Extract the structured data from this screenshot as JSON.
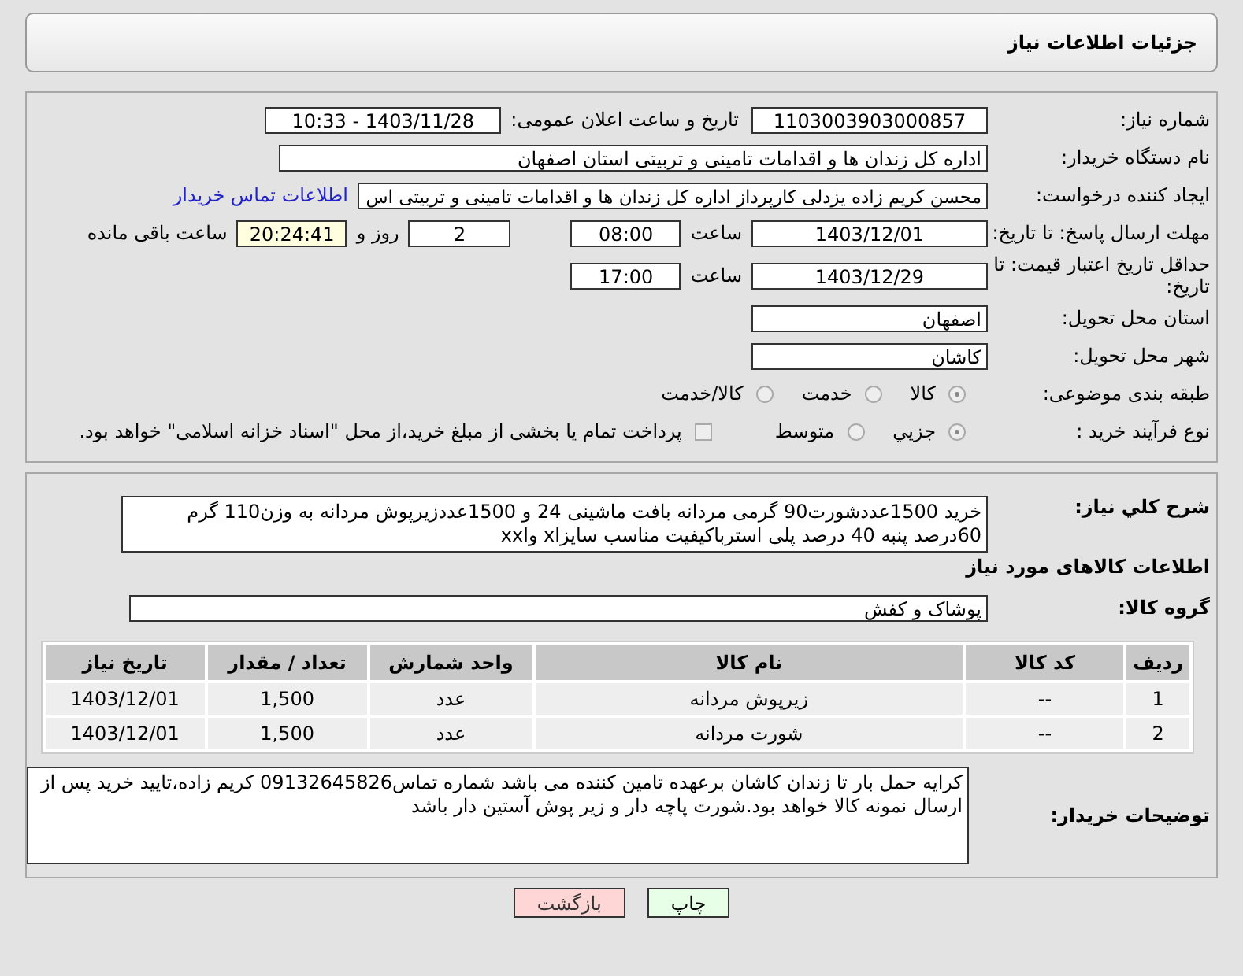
{
  "header": {
    "title": "جزئیات اطلاعات نیاز"
  },
  "need_number": {
    "label": "شماره نیاز:",
    "value": "1103003903000857"
  },
  "announce": {
    "label": "تاریخ و ساعت اعلان عمومی:",
    "value": "1403/11/28 - 10:33"
  },
  "buyer_org": {
    "label": "نام دستگاه خریدار:",
    "value": "اداره کل زندان ها و اقدامات تامینی و تربیتی استان اصفهان"
  },
  "creator": {
    "label": "ایجاد کننده درخواست:",
    "value": "محسن کریم زاده یزدلی کارپرداز اداره کل زندان ها و اقدامات تامینی و تربیتی اس",
    "link": "اطلاعات تماس خریدار"
  },
  "reply_deadline": {
    "label": "مهلت ارسال پاسخ: تا تاریخ:",
    "date": "1403/12/01",
    "time_label": "ساعت",
    "time": "08:00",
    "days": "2",
    "days_label": "روز و",
    "remaining": "20:24:41",
    "remaining_label": "ساعت باقی مانده"
  },
  "price_validity": {
    "label": "حداقل تاریخ اعتبار قیمت: تا تاریخ:",
    "date": "1403/12/29",
    "time_label": "ساعت",
    "time": "17:00"
  },
  "province": {
    "label": "استان محل تحویل:",
    "value": "اصفهان"
  },
  "city": {
    "label": "شهر محل تحویل:",
    "value": "کاشان"
  },
  "category": {
    "label": "طبقه بندی موضوعی:",
    "options": [
      {
        "label": "کالا",
        "selected": true
      },
      {
        "label": "خدمت",
        "selected": false
      },
      {
        "label": "کالا/خدمت",
        "selected": false
      }
    ]
  },
  "process": {
    "label": "نوع فرآیند خرید :",
    "options": [
      {
        "label": "جزیي",
        "selected": true
      },
      {
        "label": "متوسط",
        "selected": false
      }
    ],
    "payment": {
      "checked": false,
      "text": "پرداخت تمام یا بخشی از مبلغ خرید،از محل \"اسناد خزانه اسلامی\" خواهد بود."
    }
  },
  "description": {
    "label": "شرح کلي نياز:",
    "value": "خرید 1500عددشورت90 گرمی مردانه بافت ماشینی 24 و 1500عددزیرپوش  مردانه به وزن110 گرم 60درصد پنبه 40 درصد پلی استرباکیفیت مناسب سایزxl وxxl"
  },
  "goods_title": "اطلاعات کالاهای مورد نیاز",
  "goods_group": {
    "label": "گروه کالا:",
    "value": "پوشاک و کفش"
  },
  "table": {
    "columns": [
      "ردیف",
      "کد کالا",
      "نام کالا",
      "واحد شمارش",
      "تعداد / مقدار",
      "تاریخ نیاز"
    ],
    "rows": [
      [
        "1",
        "--",
        "زیرپوش مردانه",
        "عدد",
        "1,500",
        "1403/12/01"
      ],
      [
        "2",
        "--",
        "شورت مردانه",
        "عدد",
        "1,500",
        "1403/12/01"
      ]
    ]
  },
  "buyer_notes": {
    "label": "توضیحات خریدار:",
    "value": "کرایه حمل بار تا زندان کاشان برعهده تامین کننده می باشد شماره تماس09132645826 کریم زاده،تایید خرید پس از ارسال نمونه کالا خواهد بود.شورت پاچه دار و زیر پوش آستین دار باشد"
  },
  "buttons": [
    {
      "label": "چاپ",
      "kind": "print"
    },
    {
      "label": "بازگشت",
      "kind": "back"
    }
  ]
}
